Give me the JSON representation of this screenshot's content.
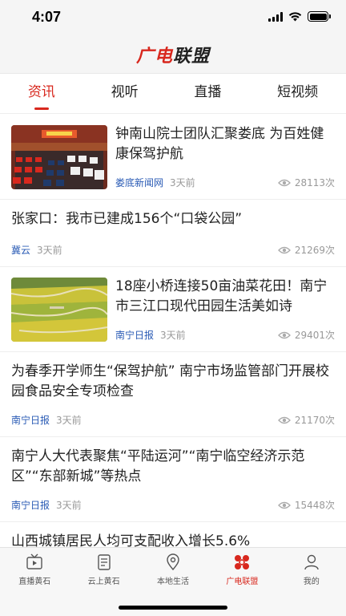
{
  "status_bar": {
    "time": "4:07"
  },
  "header": {
    "logo_part1": "广电",
    "logo_part2": "联盟"
  },
  "tabs": [
    {
      "label": "资讯",
      "active": true
    },
    {
      "label": "视听",
      "active": false
    },
    {
      "label": "直播",
      "active": false
    },
    {
      "label": "短视频",
      "active": false
    }
  ],
  "feed": [
    {
      "title": "钟南山院士团队汇聚娄底 为百姓健康保驾护航",
      "source": "娄底新闻网",
      "time": "3天前",
      "views": "28113次",
      "thumb": "conference-hall"
    },
    {
      "title": "张家口：我市已建成156个“口袋公园”",
      "source": "冀云",
      "time": "3天前",
      "views": "21269次"
    },
    {
      "title": "18座小桥连接50亩油菜花田！南宁市三江口现代田园生活美如诗",
      "source": "南宁日报",
      "time": "3天前",
      "views": "29401次",
      "thumb": "rapeseed-field"
    },
    {
      "title": "为春季开学师生“保驾护航” 南宁市场监管部门开展校园食品安全专项检查",
      "source": "南宁日报",
      "time": "3天前",
      "views": "21170次"
    },
    {
      "title": "南宁人大代表聚焦“平陆运河”“南宁临空经济示范区”“东部新城”等热点",
      "source": "南宁日报",
      "time": "3天前",
      "views": "15448次"
    },
    {
      "title": "山西城镇居民人均可支配收入增长5.6%"
    }
  ],
  "bottom_nav": [
    {
      "label": "直播黄石",
      "icon": "tv-icon",
      "active": false
    },
    {
      "label": "云上黄石",
      "icon": "document-icon",
      "active": false
    },
    {
      "label": "本地生活",
      "icon": "location-pin-icon",
      "active": false
    },
    {
      "label": "广电联盟",
      "icon": "alliance-logo-icon",
      "active": true
    },
    {
      "label": "我的",
      "icon": "user-icon",
      "active": false
    }
  ],
  "colors": {
    "accent": "#d8281e",
    "source_blue": "#2a5bb5"
  }
}
